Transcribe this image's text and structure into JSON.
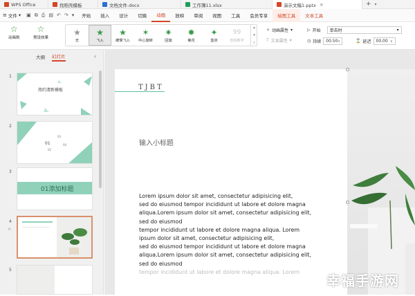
{
  "titlebar": {
    "tabs": [
      {
        "label": "WPS Office",
        "color": "#d24726"
      },
      {
        "label": "找稻壳模板",
        "color": "#d24726"
      },
      {
        "label": "文档文件.docx",
        "color": "#2b6fd6"
      },
      {
        "label": "工作簿11.xlsx",
        "color": "#1e9e5a"
      },
      {
        "label": "演示文稿1.pptx",
        "color": "#d24726"
      }
    ],
    "add": "+"
  },
  "menubar": {
    "file": "文件",
    "items": [
      "开始",
      "插入",
      "设计",
      "切换",
      "动画",
      "放映",
      "审阅",
      "视图",
      "工具",
      "会员专享",
      "绘图工具",
      "文本工具"
    ],
    "selected": "动画"
  },
  "ribbon": {
    "preview": "动画刷",
    "preset": "预设效果",
    "effects": [
      "无",
      "飞入",
      "缓慢飞入",
      "中心旋转",
      "回旋",
      "菊花",
      "盒状",
      "自动数字"
    ],
    "attr1": "动画属性",
    "attr2": "文本属性",
    "start_label": "开始",
    "start_value": "单击时",
    "duration_label": "持续",
    "duration_value": "00.50",
    "delay_label": "延迟",
    "delay_value": "00.00"
  },
  "leftpanel": {
    "tab_outline": "大纲",
    "tab_slides": "幻灯片",
    "slides": [
      {
        "num": "1",
        "title": "简约清新模板"
      },
      {
        "num": "2",
        "title": "01",
        "lines": [
          "03",
          "02",
          "04"
        ]
      },
      {
        "num": "3",
        "title": "01添加标题"
      },
      {
        "num": "4",
        "title": ""
      },
      {
        "num": "5",
        "title": ""
      }
    ]
  },
  "slide": {
    "brand": "TJBT",
    "subtitle": "输入小标题",
    "body_lines": [
      "Lorem ipsum dolor sit amet, consectetur adipisicing elit,",
      "sed do eiusmod tempor incididunt ut labore et dolore magna",
      "aliqua.Lorem ipsum dolor sit amet, consectetur adipisicing elit,",
      "sed do eiusmod",
      "tempor incididunt ut labore et dolore magna aliqua. Lorem",
      "ipsum dolor sit amet, consectetur adipisicing elit,",
      "sed do eiusmod tempor incididunt ut labore et dolore magna",
      "aliqua.Lorem ipsum dolor sit amet, consectetur adipisicing elit,",
      "sed do eiusmod"
    ],
    "faint_line": "tempor incididunt ut labore et dolore magna aliqua. Lorem"
  },
  "watermark": "幸福手游网"
}
